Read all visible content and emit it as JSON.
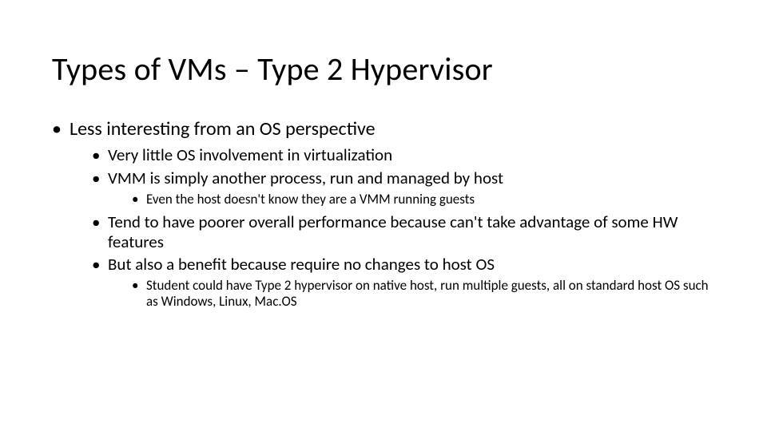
{
  "title": "Types of VMs – Type 2 Hypervisor",
  "bullets": {
    "l1_0": "Less interesting from an OS perspective",
    "l2_0": "Very little OS involvement in virtualization",
    "l2_1": "VMM is simply another process, run and managed by host",
    "l3_0": "Even the host doesn't know they are a VMM running guests",
    "l2_2": "Tend to have poorer overall performance because can't take advantage of some HW features",
    "l2_3": "But also a benefit because require no changes to host OS",
    "l3_1": "Student could have Type 2 hypervisor on native host, run multiple guests, all on standard host OS such as Windows, Linux, Mac.OS"
  }
}
